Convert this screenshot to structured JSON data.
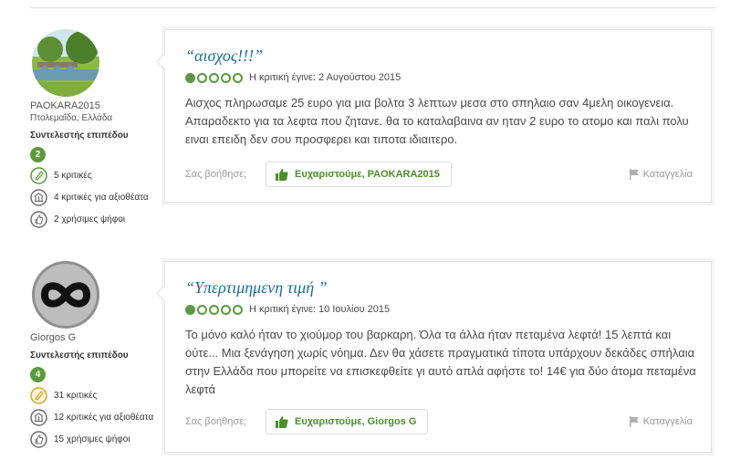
{
  "reviews": [
    {
      "member": {
        "username": "PAOKARA2015",
        "location": "Πτολεμαΐδα, Ελλάδα",
        "level_label": "Συντελεστής επιπέδου",
        "level": "2",
        "badges": [
          {
            "icon": "pencil-review-icon",
            "text": "5 κριτικές"
          },
          {
            "icon": "attraction-icon",
            "text": "4 κριτικές για αξιοθέατα"
          },
          {
            "icon": "thumbs-up-vote-icon",
            "text": "2 χρήσιμες ψήφοι"
          }
        ]
      },
      "title": "“αισχος!!!”",
      "rating": 1,
      "date": "Η κριτική έγινε: 2 Αυγούστου 2015",
      "body": "Αισχος πληρωσαμε 25 ευρο για μια βολτα 3 λεπτων μεσα στο σπηλαιο σαν 4μελη οικογενεια. Απαραδεκτο για τα λεφτα που ζητανε. θα το καταλαβαινα αν ηταν 2 ευρο το ατομο και παλι πολυ ειναι επειδη δεν σου προσφερει και τιποτα ιδιαιτερο.",
      "helpful_label": "Σας βοήθησε;",
      "thanks_label": "Ευχαριστούμε, PAOKARA2015",
      "report_label": "Καταγγελία"
    },
    {
      "member": {
        "username": "Giorgos G",
        "location": "",
        "level_label": "Συντελεστής επιπέδου",
        "level": "4",
        "badges": [
          {
            "icon": "pencil-review-icon",
            "text": "31 κριτικές"
          },
          {
            "icon": "attraction-icon",
            "text": "12 κριτικές για αξιοθέατα"
          },
          {
            "icon": "thumbs-up-vote-icon",
            "text": "15 χρήσιμες ψήφοι"
          }
        ]
      },
      "title": "“Υπερτιμημενη τιμή ”",
      "rating": 1,
      "date": "Η κριτική έγινε: 10 Ιουλίου 2015",
      "body": "Το μόνο καλό ήταν το χιούμορ του βαρκαρη. Όλα τα άλλα ήταν πεταμένα λεφτά! 15 λεπτά και ούτε... Μια ξενάγηση χωρίς νόημα. Δεν θα χάσετε πραγματικά τίποτα υπάρχουν δεκάδες σπήλαια στην Ελλάδα που μπορείτε να επισκεφθείτε γι αυτό απλά αφήστε το! 14€ για δύο άτομα πεταμένα λεφτά",
      "helpful_label": "Σας βοήθησε;",
      "thanks_label": "Ευχαριστούμε, Giorgos G",
      "report_label": "Καταγγελία"
    }
  ],
  "colors": {
    "title": "#1b6e9c",
    "rating_green": "#5a9a3c",
    "thanks_green": "#4b8f2b"
  }
}
